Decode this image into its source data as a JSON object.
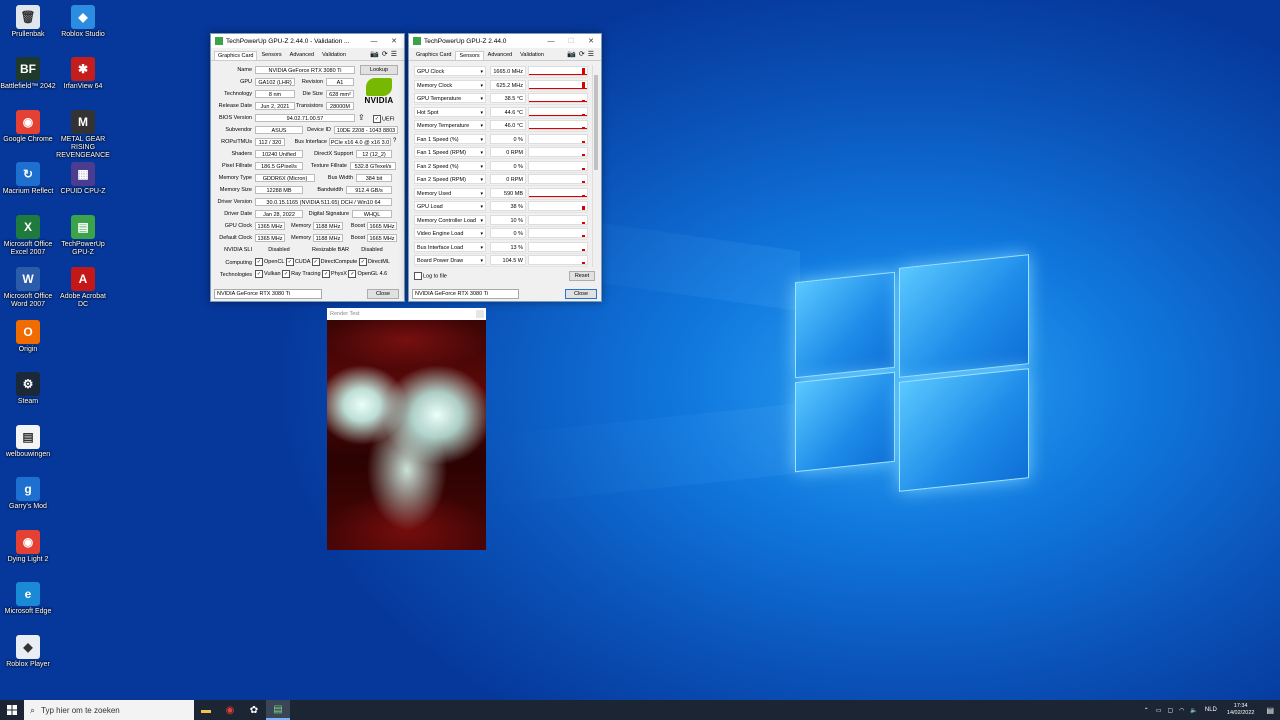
{
  "desktop_icons": [
    {
      "label": "Prullenbak",
      "icon": "recycle-bin-icon",
      "color": "#dfe6ee",
      "glyph": "🗑"
    },
    {
      "label": "Battlefield™ 2042",
      "icon": "battlefield-icon",
      "color": "#1f3a2a",
      "glyph": "BF"
    },
    {
      "label": "Google Chrome",
      "icon": "chrome-icon",
      "color": "#e44134",
      "glyph": "◉"
    },
    {
      "label": "Macrium Reflect",
      "icon": "macrium-icon",
      "color": "#1d6fd0",
      "glyph": "↻"
    },
    {
      "label": "Microsoft Office Excel 2007",
      "icon": "excel-icon",
      "color": "#1f7a3d",
      "glyph": "X"
    },
    {
      "label": "Microsoft Office Word 2007",
      "icon": "word-icon",
      "color": "#2b5caa",
      "glyph": "W"
    },
    {
      "label": "Origin",
      "icon": "origin-icon",
      "color": "#f06c00",
      "glyph": "O"
    },
    {
      "label": "Steam",
      "icon": "steam-icon",
      "color": "#1b2838",
      "glyph": "⚙"
    },
    {
      "label": "welbouwingen",
      "icon": "file-icon",
      "color": "#f4f4f4",
      "glyph": "▤"
    },
    {
      "label": "Garry's Mod",
      "icon": "gmod-icon",
      "color": "#1d6fd0",
      "glyph": "g"
    },
    {
      "label": "Dying Light 2",
      "icon": "chrome-icon",
      "color": "#e44134",
      "glyph": "◉"
    },
    {
      "label": "Microsoft Edge",
      "icon": "edge-icon",
      "color": "#1a8ad6",
      "glyph": "e"
    },
    {
      "label": "Roblox Player",
      "icon": "roblox-icon",
      "color": "#e9eef4",
      "glyph": "◆"
    },
    {
      "label": "Roblox Studio",
      "icon": "roblox-studio-icon",
      "color": "#2b8ce0",
      "glyph": "◆"
    },
    {
      "label": "IrfanView 64",
      "icon": "irfanview-icon",
      "color": "#c41d1d",
      "glyph": "✱"
    },
    {
      "label": "METAL GEAR RISING REVENGEANCE",
      "icon": "mgr-icon",
      "color": "#333333",
      "glyph": "M"
    },
    {
      "label": "CPUID CPU-Z",
      "icon": "cpuz-icon",
      "color": "#4a3c8f",
      "glyph": "▦"
    },
    {
      "label": "TechPowerUp GPU-Z",
      "icon": "gpuz-icon",
      "color": "#3ba34a",
      "glyph": "▤"
    },
    {
      "label": "Adobe Acrobat DC",
      "icon": "acrobat-icon",
      "color": "#c41818",
      "glyph": "A"
    }
  ],
  "gpuz_main": {
    "title": "TechPowerUp GPU-Z 2.44.0 - Validation ...",
    "tabs": [
      "Graphics Card",
      "Sensors",
      "Advanced",
      "Validation"
    ],
    "name": "NVIDIA GeForce RTX 3080 Ti",
    "lookup": "Lookup",
    "gpu": "GA102 (LHR)",
    "revision": "A1",
    "technology": "8 nm",
    "die_size": "628 mm²",
    "release_date": "Jun 2, 2021",
    "transistors": "28000M",
    "bios": "94.02.71.00.57",
    "uefi": "UEFI",
    "subvendor": "ASUS",
    "device_id": "10DE 2208 - 1043 8803",
    "rops": "112 / 320",
    "bus_interface": "PCIe x16 4.0 @ x16 3.0",
    "shaders": "10240 Unified",
    "directx": "12 (12_2)",
    "pixel_fillrate": "186.5 GPixel/s",
    "texture_fillrate": "532.8 GTexel/s",
    "memory_type": "GDDR6X (Micron)",
    "bus_width": "384 bit",
    "memory_size": "12288 MB",
    "bandwidth": "912.4 GB/s",
    "driver_version": "30.0.15.1165 (NVIDIA 511.65) DCH / Win10 64",
    "driver_date": "Jan 28, 2022",
    "digital_signature": "WHQL",
    "gpu_clock": "1365 MHz",
    "memory_clock": "1188 MHz",
    "boost_clock": "1665 MHz",
    "default_clock": "1365 MHz",
    "default_memory": "1188 MHz",
    "default_boost": "1665 MHz",
    "sli": "Disabled",
    "resizable_bar": "Disabled",
    "computing": [
      "OpenCL",
      "CUDA",
      "DirectCompute",
      "DirectML"
    ],
    "technologies": [
      "Vulkan",
      "Ray Tracing",
      "PhysX",
      "OpenGL 4.6"
    ],
    "labels": {
      "name": "Name",
      "gpu": "GPU",
      "revision": "Revision",
      "technology": "Technology",
      "die_size": "Die Size",
      "release_date": "Release Date",
      "transistors": "Transistors",
      "bios": "BIOS Version",
      "subvendor": "Subvendor",
      "device_id": "Device ID",
      "rops": "ROPs/TMUs",
      "bus_interface": "Bus Interface",
      "shaders": "Shaders",
      "directx": "DirectX Support",
      "pixel_fillrate": "Pixel Fillrate",
      "texture_fillrate": "Texture Fillrate",
      "memory_type": "Memory Type",
      "bus_width": "Bus Width",
      "memory_size": "Memory Size",
      "bandwidth": "Bandwidth",
      "driver_version": "Driver Version",
      "driver_date": "Driver Date",
      "digital_signature": "Digital Signature",
      "gpu_clock": "GPU Clock",
      "memory": "Memory",
      "boost": "Boost",
      "default_clock": "Default Clock",
      "sli": "NVIDIA SLI",
      "resizable_bar": "Resizable BAR",
      "computing": "Computing",
      "technologies": "Technologies"
    },
    "logo_text": "NVIDIA",
    "device_select": "NVIDIA GeForce RTX 3080 Ti",
    "close": "Close"
  },
  "gpuz_sensors": {
    "title": "TechPowerUp GPU-Z 2.44.0",
    "tabs": [
      "Graphics Card",
      "Sensors",
      "Advanced",
      "Validation"
    ],
    "rows": [
      {
        "name": "GPU Clock",
        "value": "1665.0 MHz"
      },
      {
        "name": "Memory Clock",
        "value": "625.2 MHz"
      },
      {
        "name": "GPU Temperature",
        "value": "38.5 °C"
      },
      {
        "name": "Hot Spot",
        "value": "44.6 °C"
      },
      {
        "name": "Memory Temperature",
        "value": "46.0 °C"
      },
      {
        "name": "Fan 1 Speed (%)",
        "value": "0 %"
      },
      {
        "name": "Fan 1 Speed (RPM)",
        "value": "0 RPM"
      },
      {
        "name": "Fan 2 Speed (%)",
        "value": "0 %"
      },
      {
        "name": "Fan 2 Speed (RPM)",
        "value": "0 RPM"
      },
      {
        "name": "Memory Used",
        "value": "590 MB"
      },
      {
        "name": "GPU Load",
        "value": "38 %"
      },
      {
        "name": "Memory Controller Load",
        "value": "10 %"
      },
      {
        "name": "Video Engine Load",
        "value": "0 %"
      },
      {
        "name": "Bus Interface Load",
        "value": "13 %"
      },
      {
        "name": "Board Power Draw",
        "value": "104.5 W"
      }
    ],
    "log_to_file": "Log to file",
    "reset": "Reset",
    "device_select": "NVIDIA GeForce RTX 3080 Ti",
    "close": "Close"
  },
  "render_test": {
    "title": "Render Test"
  },
  "taskbar": {
    "search_placeholder": "Typ hier om te zoeken",
    "language": "NLD",
    "time": "17:34",
    "date": "14/02/2022"
  }
}
